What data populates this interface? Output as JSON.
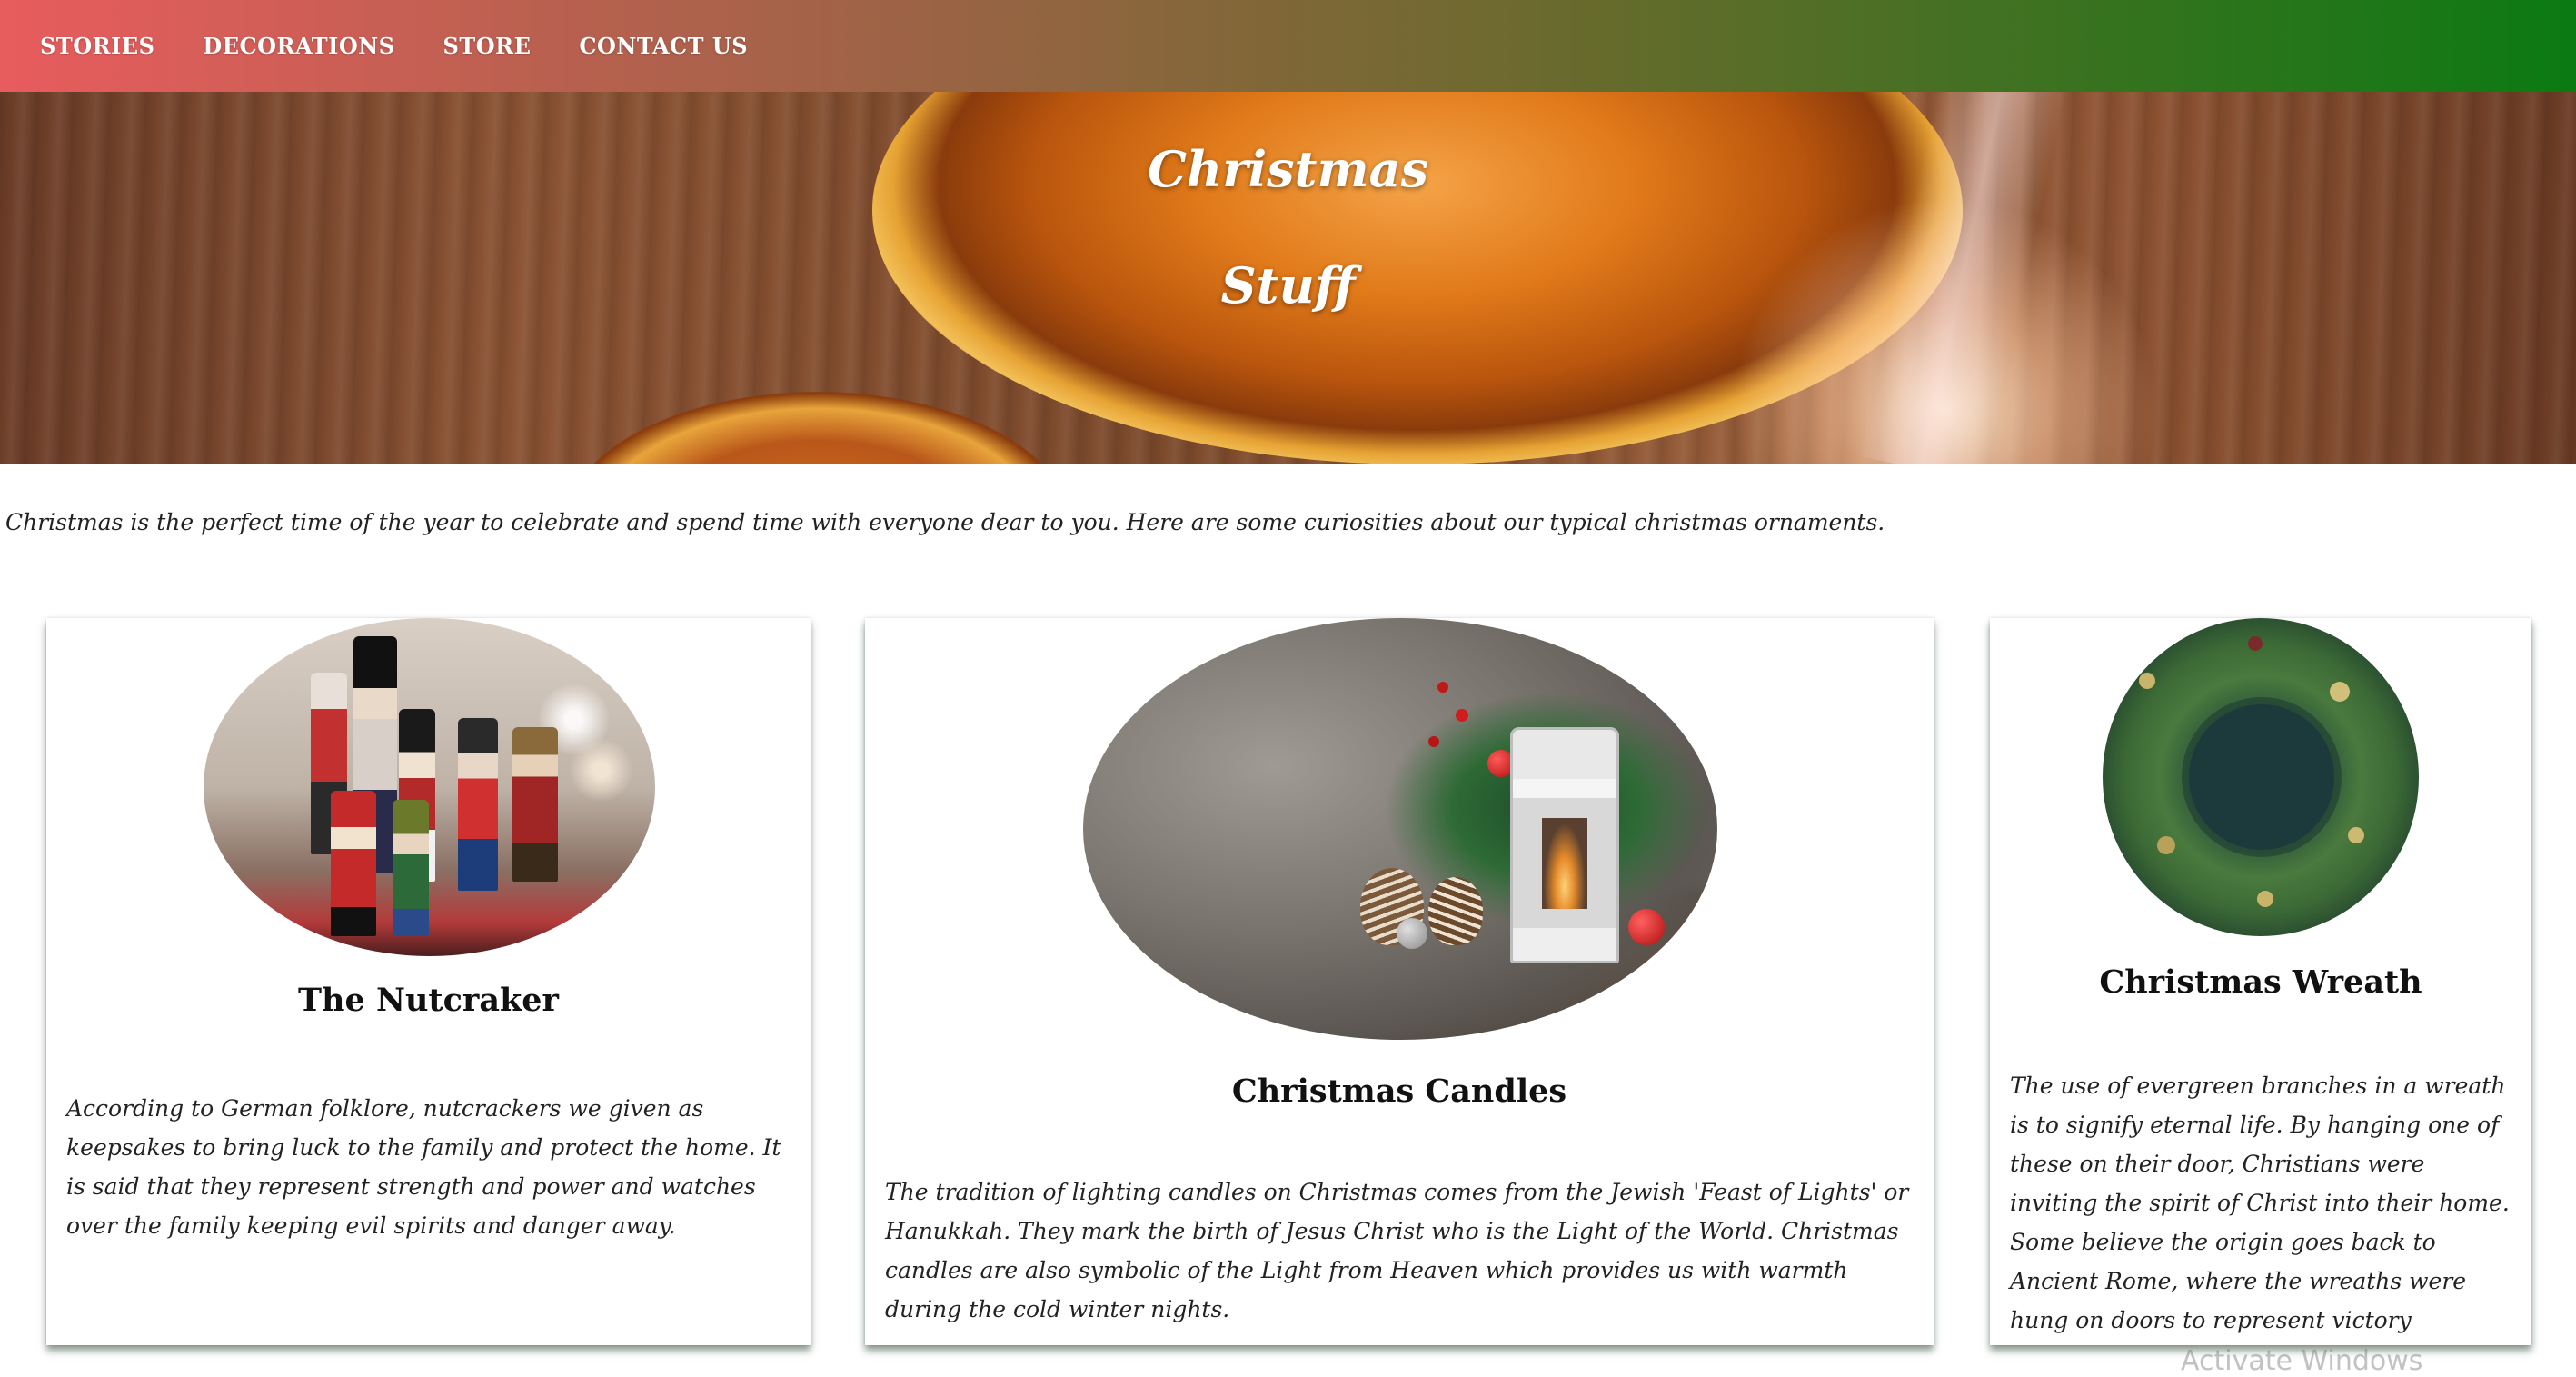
{
  "nav": {
    "items": [
      {
        "label": "STORIES"
      },
      {
        "label": "DECORATIONS"
      },
      {
        "label": "STORE"
      },
      {
        "label": "CONTACT US"
      }
    ]
  },
  "hero": {
    "title_line1": "Christmas",
    "title_line2": "Stuff"
  },
  "intro": "Christmas is the perfect time of the year to celebrate and spend time with everyone dear to you. Here are some curiosities about our typical christmas ornaments.",
  "cards": [
    {
      "title": "The Nutcraker",
      "text": "According to German folklore, nutcrackers we given as keepsakes to bring luck to the family and protect the home. It is said that they represent strength and power and watches over the family keeping evil spirits and danger away."
    },
    {
      "title": "Christmas Candles",
      "text": "The tradition of lighting candles on Christmas comes from the Jewish 'Feast of Lights' or Hanukkah. They mark the birth of Jesus Christ who is the Light of the World. Christmas candles are also symbolic of the Light from Heaven which provides us with warmth during the cold winter nights."
    },
    {
      "title": "Christmas Wreath",
      "text": "The use of evergreen branches in a wreath is to signify eternal life. By hanging one of these on their door, Christians were inviting the spirit of Christ into their home. Some believe the origin goes back to Ancient Rome, where the wreaths were hung on doors to represent victory"
    }
  ],
  "watermark": "Activate Windows",
  "colors": {
    "nav_gradient_start": "#e85c5e",
    "nav_gradient_end": "#0b7a12"
  }
}
